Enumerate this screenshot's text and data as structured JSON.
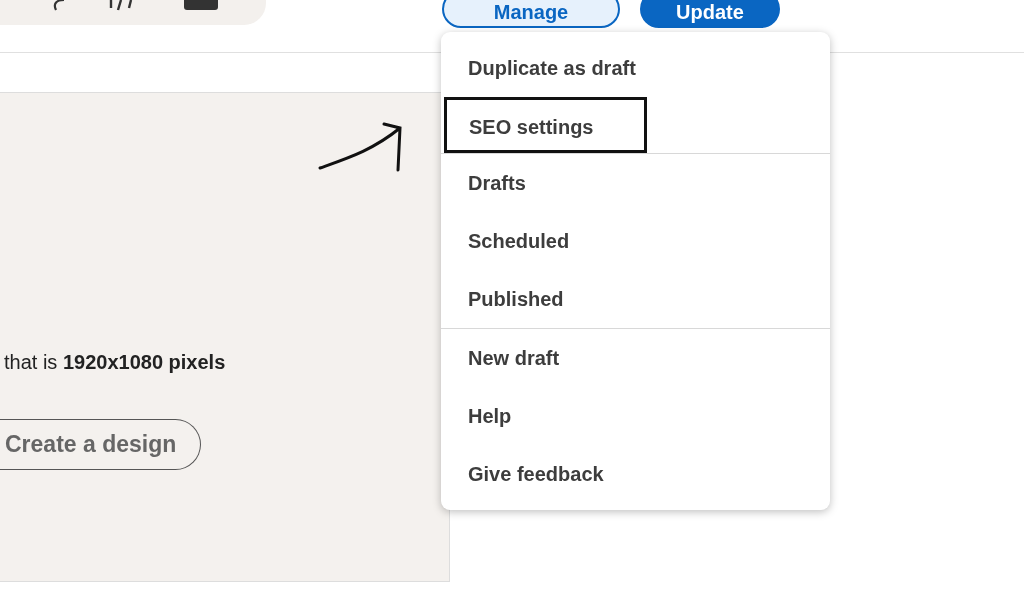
{
  "toolbar": {
    "buttons": [
      {
        "label": "Manage",
        "kind": "secondary"
      },
      {
        "label": "Update",
        "kind": "primary"
      }
    ]
  },
  "panel": {
    "info": "that is **1920x1080 pixels**",
    "button": "Create a design"
  },
  "menu": {
    "sections": [
      [
        {
          "label": "Duplicate as draft",
          "highlighted": false
        },
        {
          "label": "SEO settings",
          "highlighted": true
        }
      ],
      [
        {
          "label": "Drafts",
          "highlighted": false
        },
        {
          "label": "Scheduled",
          "highlighted": false
        },
        {
          "label": "Published",
          "highlighted": false
        }
      ],
      [
        {
          "label": "New draft",
          "highlighted": false
        },
        {
          "label": "Help",
          "highlighted": false
        },
        {
          "label": "Give feedback",
          "highlighted": false
        }
      ]
    ]
  }
}
